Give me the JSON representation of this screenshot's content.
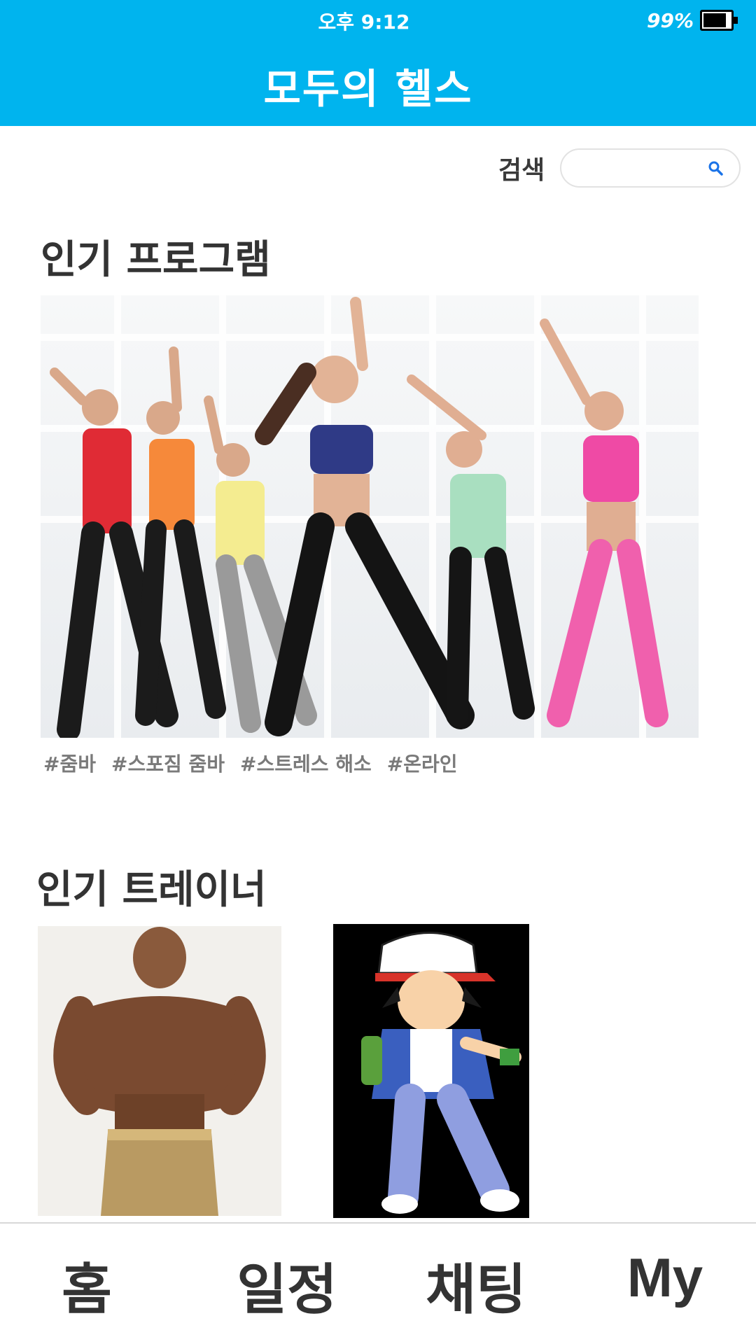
{
  "status_bar": {
    "time": "오후 9:12",
    "battery_percent": "99%",
    "battery_level": 0.99
  },
  "header": {
    "title": "모두의 헬스",
    "background_color": "#00b4ee"
  },
  "search": {
    "label": "검색",
    "value": "",
    "placeholder": "",
    "icon": "search-icon",
    "icon_color": "#1a73e8"
  },
  "popular_programs": {
    "title": "인기 프로그램",
    "image_alt": "dance fitness class",
    "tags": [
      "#줌바",
      "#스포짐 줌바",
      "#스트레스 해소",
      "#온라인"
    ]
  },
  "popular_trainers": {
    "title": "인기 트레이너",
    "trainers": [
      {
        "image_alt": "muscular trainer"
      },
      {
        "image_alt": "cartoon trainer"
      }
    ]
  },
  "bottom_nav": {
    "items": [
      {
        "label": "홈"
      },
      {
        "label": "일정"
      },
      {
        "label": "채팅"
      },
      {
        "label": "My"
      }
    ]
  }
}
